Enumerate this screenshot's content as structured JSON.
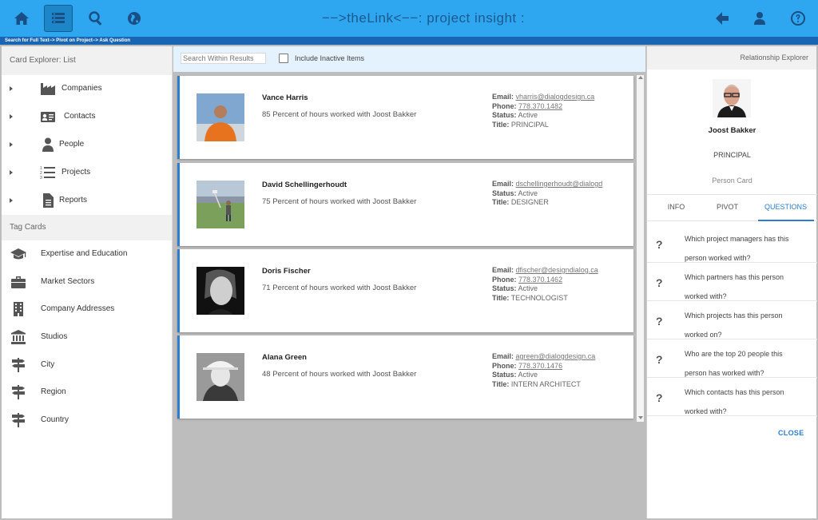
{
  "app": {
    "title": "−−>theLink<−−: project insight :",
    "breadcrumb": "Search for Full Text−> Pivot on Project−> Ask Question"
  },
  "toolbar": {
    "left_icons": [
      "home-icon",
      "list-icon",
      "search-icon",
      "globe-icon"
    ],
    "right_icons": [
      "back-arrow-icon",
      "user-icon",
      "help-icon"
    ]
  },
  "card_explorer": {
    "title": "Card Explorer: List",
    "items": [
      {
        "label": "Companies",
        "icon": "factory-icon"
      },
      {
        "label": "Contacts",
        "icon": "contact-card-icon"
      },
      {
        "label": "People",
        "icon": "person-icon"
      },
      {
        "label": "Projects",
        "icon": "numbered-list-icon"
      },
      {
        "label": "Reports",
        "icon": "document-icon"
      }
    ]
  },
  "tag_cards": {
    "title": "Tag Cards",
    "items": [
      {
        "label": "Expertise and Education",
        "icon": "graduation-cap-icon"
      },
      {
        "label": "Market Sectors",
        "icon": "briefcase-icon"
      },
      {
        "label": "Company Addresses",
        "icon": "building-icon"
      },
      {
        "label": "Studios",
        "icon": "institution-icon"
      },
      {
        "label": "City",
        "icon": "signpost-icon"
      },
      {
        "label": "Region",
        "icon": "signpost-icon"
      },
      {
        "label": "Country",
        "icon": "signpost-icon"
      }
    ]
  },
  "filter": {
    "search_placeholder": "Search Within Results",
    "include_inactive_label": "Include Inactive Items",
    "include_inactive_checked": false
  },
  "results": [
    {
      "name": "Vance Harris",
      "desc": "85 Percent of hours worked with Joost Bakker",
      "email": "vharris@dialogdesign.ca",
      "phone": "778.370.1482",
      "status": "Active",
      "title": "PRINCIPAL"
    },
    {
      "name": "David Schellingerhoudt",
      "desc": "75 Percent of hours worked with Joost Bakker",
      "email": "dschellingerhoudt@dialogd",
      "phone": null,
      "status": "Active",
      "title": "DESIGNER"
    },
    {
      "name": "Doris Fischer",
      "desc": "71 Percent of hours worked with Joost Bakker",
      "email": "dfischer@designdialog.ca",
      "phone": "778.370.1462",
      "status": "Active",
      "title": "TECHNOLOGIST"
    },
    {
      "name": "Alana Green",
      "desc": "48 Percent of hours worked with Joost Bakker",
      "email": "agreen@dialogdesign.ca",
      "phone": "778.370.1476",
      "status": "Active",
      "title": "INTERN ARCHITECT"
    }
  ],
  "labels": {
    "email": "Email:",
    "phone": "Phone:",
    "status": "Status:",
    "title": "Title:"
  },
  "relationship": {
    "header": "Relationship Explorer",
    "name": "Joost Bakker",
    "title": "PRINCIPAL",
    "card_type": "Person Card",
    "tabs": [
      "INFO",
      "PIVOT",
      "QUESTIONS"
    ],
    "active_tab": "QUESTIONS",
    "questions": [
      "Which project managers has this person worked with?",
      "Which partners has this person worked with?",
      "Which projects has this person worked on?",
      "Who are the top 20 people this person has worked with?",
      "Which contacts has this person worked with?"
    ],
    "question_mark": "?",
    "close_label": "CLOSE"
  },
  "colors": {
    "topbar": "#2fa6f0",
    "subbar": "#1865b3",
    "accent": "#2a7dd1",
    "icon_dark": "#1a4f86"
  }
}
